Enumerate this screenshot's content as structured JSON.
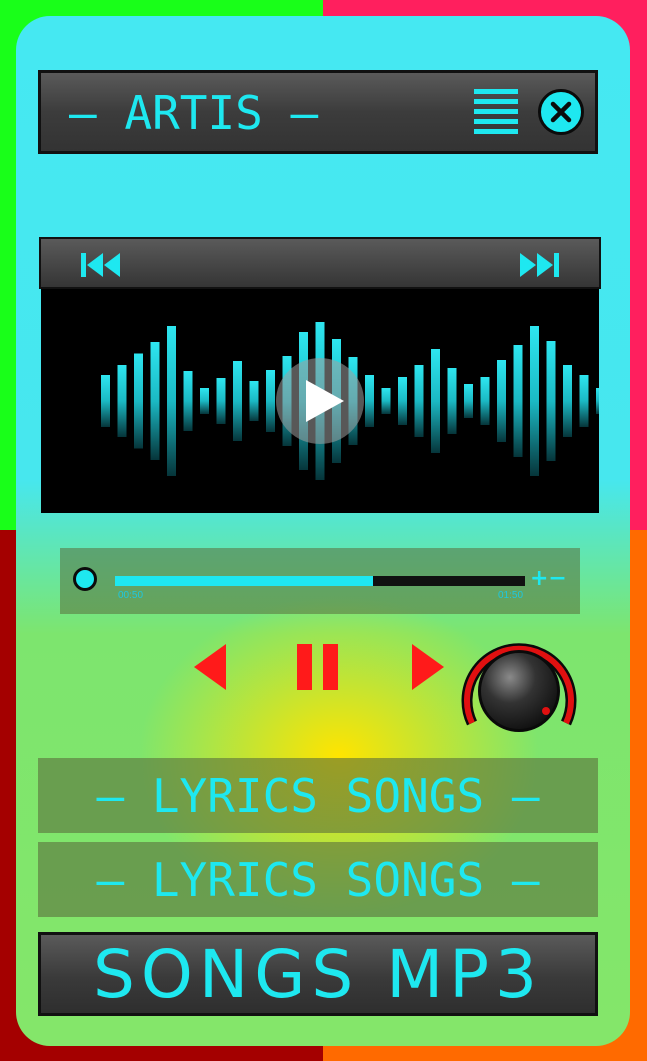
{
  "header": {
    "title": "– ARTIS –"
  },
  "player": {
    "elapsed": "00:50",
    "total": "01:50",
    "progress_fraction": 0.63,
    "plus_minus": "+−"
  },
  "menu": {
    "lyrics_1": "– LYRICS SONGS –",
    "lyrics_2": "– LYRICS SONGS –",
    "songs_mp3": "SONGS MP3"
  },
  "colors": {
    "accent": "#1ee8f0",
    "control_red": "#ff1a1a",
    "frame_green": "#19ff19",
    "frame_pink": "#ff1f5e",
    "frame_darkred": "#a40000",
    "frame_orange": "#ff6a00"
  },
  "icons": [
    "menu-icon",
    "close-icon",
    "skip-back-icon",
    "skip-forward-icon",
    "play-icon",
    "previous-icon",
    "pause-icon",
    "next-icon",
    "volume-knob-icon"
  ]
}
